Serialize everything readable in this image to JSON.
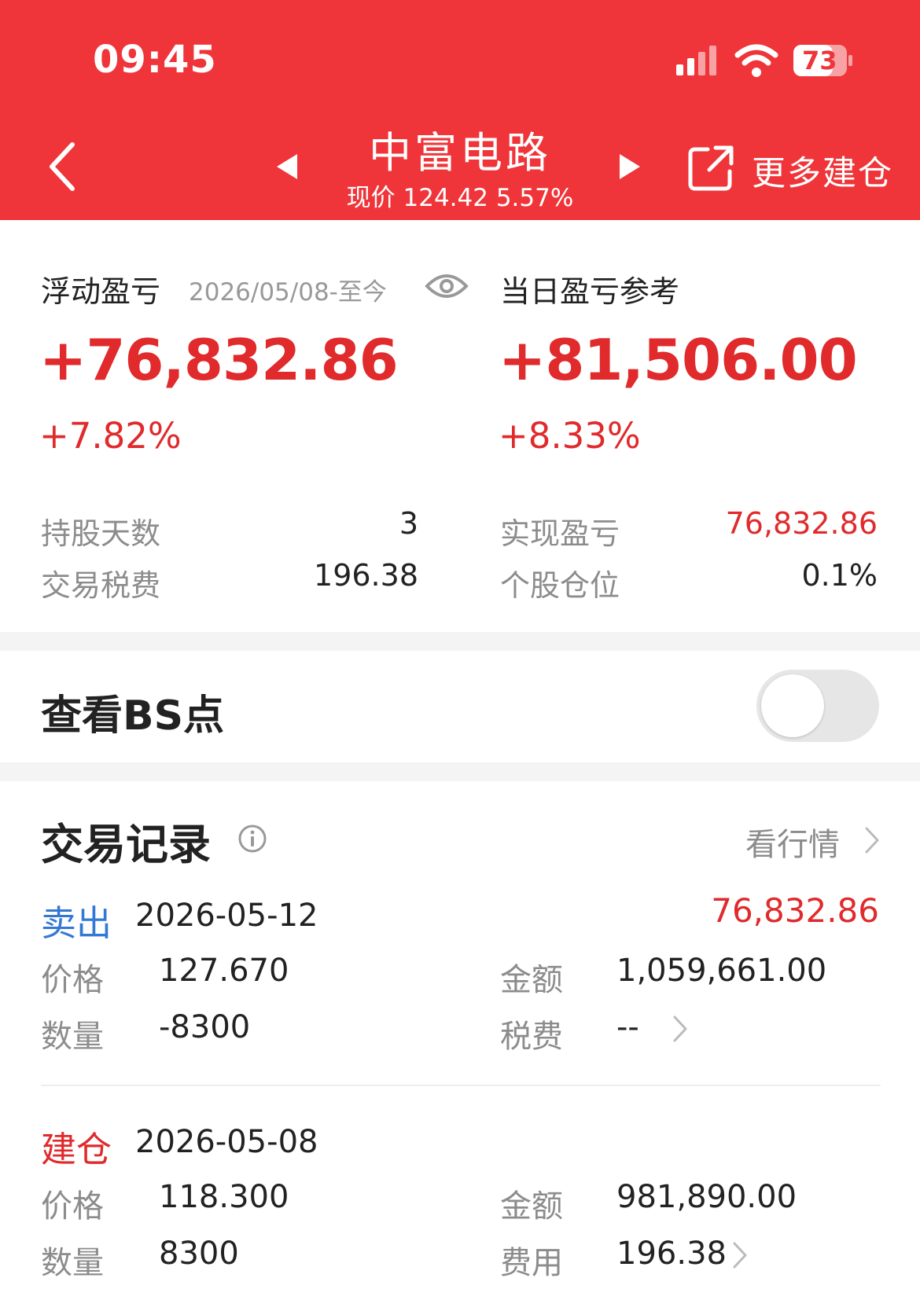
{
  "status_bar": {
    "time": "09:45",
    "battery": "73"
  },
  "header": {
    "title": "中富电路",
    "subtitle": "现价 124.42 5.57%",
    "more_label": "更多建仓"
  },
  "float_pnl": {
    "label": "浮动盈亏",
    "date_range": "2026/05/08-至今",
    "value": "+76,832.86",
    "pct": "+7.82%"
  },
  "day_pnl": {
    "label": "当日盈亏参考",
    "value": "+81,506.00",
    "pct": "+8.33%"
  },
  "stats": {
    "hold_days_label": "持股天数",
    "hold_days": "3",
    "tax_label": "交易税费",
    "tax": "196.38",
    "realized_label": "实现盈亏",
    "realized": "76,832.86",
    "position_label": "个股仓位",
    "position": "0.1%"
  },
  "bs_point": {
    "label": "查看BS点",
    "enabled": false
  },
  "records": {
    "title": "交易记录",
    "quote_link": "看行情",
    "items": [
      {
        "type": "卖出",
        "date": "2026-05-12",
        "pnl": "76,832.86",
        "price_label": "价格",
        "price": "127.670",
        "amount_label": "金额",
        "amount": "1,059,661.00",
        "qty_label": "数量",
        "qty": "-8300",
        "fee_label": "税费",
        "fee": "--"
      },
      {
        "type": "建仓",
        "date": "2026-05-08",
        "price_label": "价格",
        "price": "118.300",
        "amount_label": "金额",
        "amount": "981,890.00",
        "qty_label": "数量",
        "qty": "8300",
        "fee_label": "费用",
        "fee": "196.38"
      }
    ]
  },
  "colors": {
    "brand_red": "#ef3539",
    "profit_red": "#e02a2c",
    "sell_blue": "#3478d6"
  }
}
